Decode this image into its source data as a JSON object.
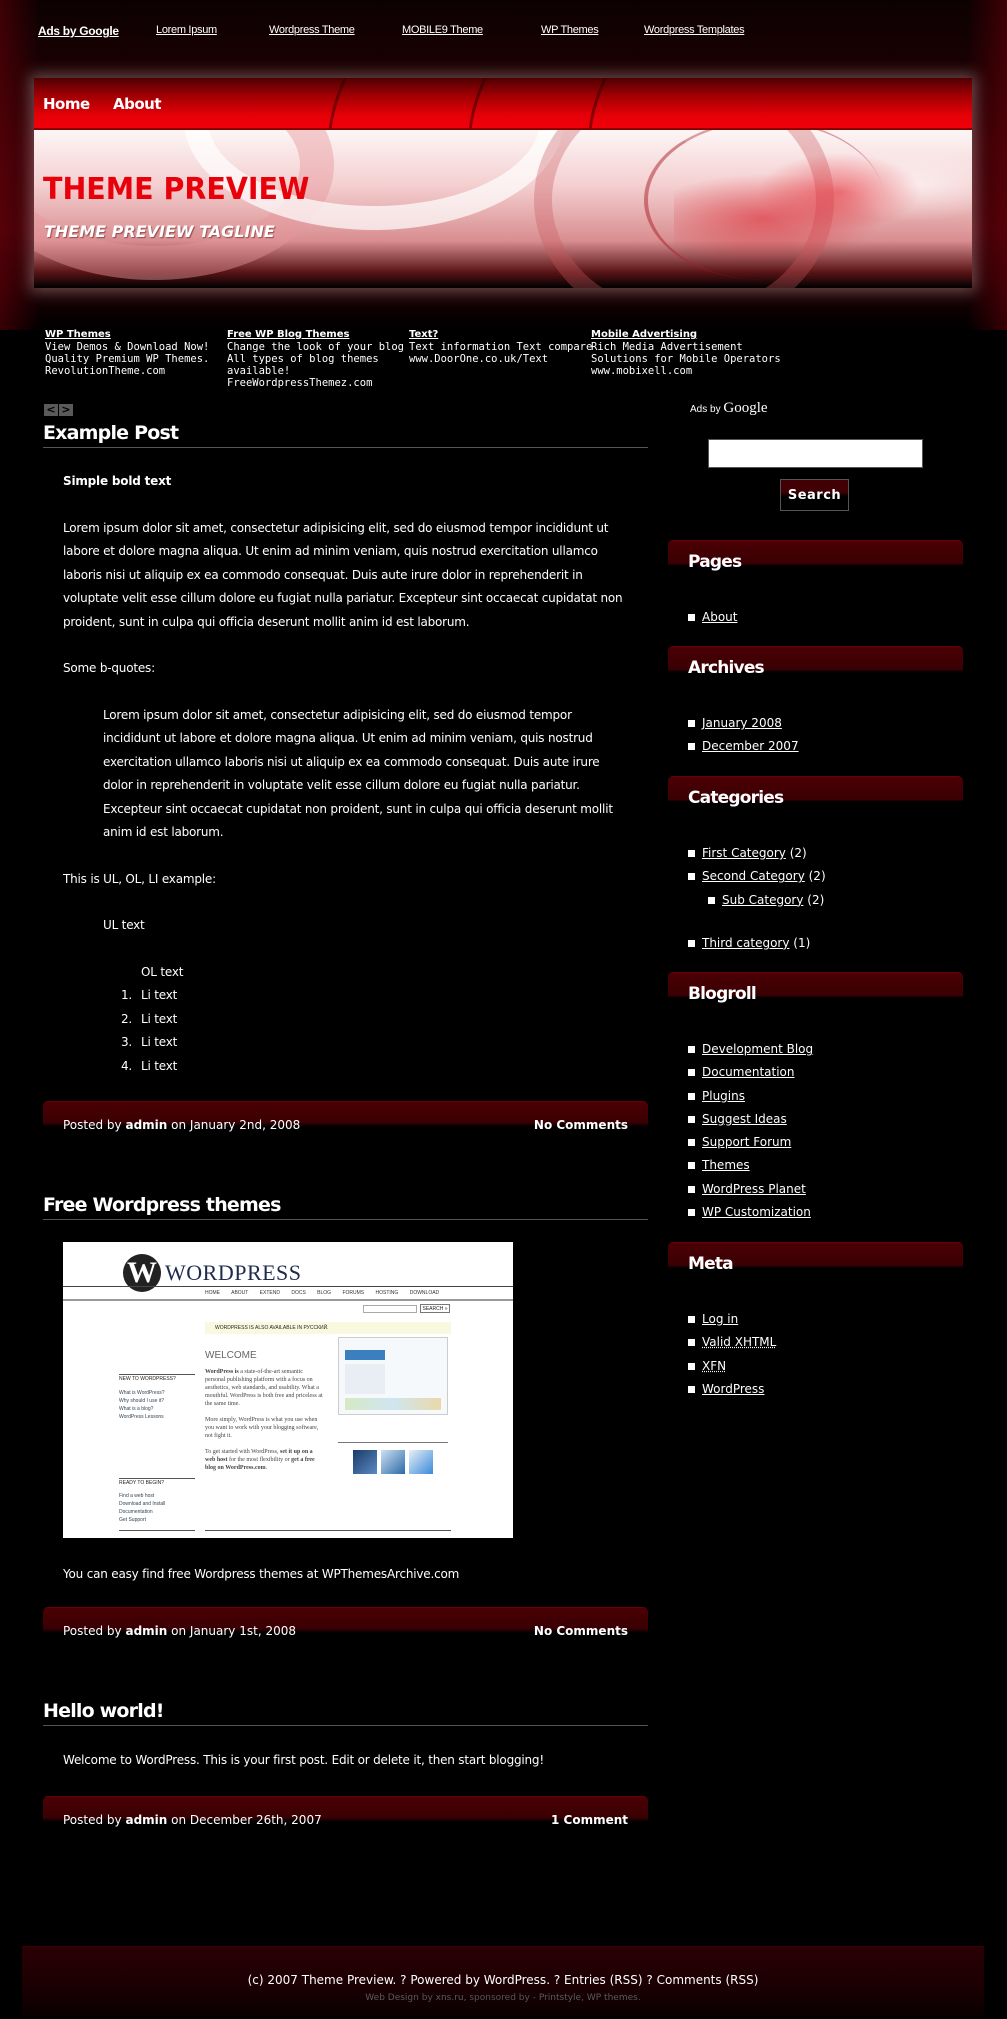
{
  "top_ads": {
    "ads_by": "Ads by Google",
    "links": [
      "Lorem Ipsum",
      "Wordpress Theme",
      "MOBILE9 Theme",
      "WP Themes",
      "Wordpress Templates"
    ]
  },
  "nav": {
    "items": [
      "Home",
      "About"
    ]
  },
  "header": {
    "title": "THEME PREVIEW",
    "tagline": "THEME PREVIEW TAGLINE"
  },
  "ad_row": [
    {
      "title": "WP Themes",
      "lines": [
        "View Demos & Download Now!",
        "Quality Premium WP Themes.",
        "RevolutionTheme.com"
      ]
    },
    {
      "title": "Free WP Blog Themes",
      "lines": [
        "Change the look of your blog",
        "All types of blog themes",
        "available!",
        "FreeWordpressThemez.com"
      ]
    },
    {
      "title": "Text?",
      "lines": [
        "Text information Text compare",
        "www.DoorOne.co.uk/Text"
      ]
    },
    {
      "title": "Mobile Advertising",
      "lines": [
        "Rich Media Advertisement",
        "Solutions for Mobile Operators",
        "www.mobixell.com"
      ]
    }
  ],
  "post_nav": {
    "prev": "<",
    "next": ">"
  },
  "posts": [
    {
      "title": "Example Post",
      "bold": "Simple bold text",
      "paragraph": "Lorem ipsum dolor sit amet, consectetur adipisicing elit, sed do eiusmod tempor incididunt ut labore et dolore magna aliqua. Ut enim ad minim veniam, quis nostrud exercitation ullamco laboris nisi ut aliquip ex ea commodo consequat. Duis aute irure dolor in reprehenderit in voluptate velit esse cillum dolore eu fugiat nulla pariatur. Excepteur sint occaecat cupidatat non proident, sunt in culpa qui officia deserunt mollit anim id est laborum.",
      "bquote_intro": "Some b-quotes:",
      "blockquote": "Lorem ipsum dolor sit amet, consectetur adipisicing elit, sed do eiusmod tempor incididunt ut labore et dolore magna aliqua. Ut enim ad minim veniam, quis nostrud exercitation ullamco laboris nisi ut aliquip ex ea commodo consequat. Duis aute irure dolor in reprehenderit in voluptate velit esse cillum dolore eu fugiat nulla pariatur. Excepteur sint occaecat cupidatat non proident, sunt in culpa qui officia deserunt mollit anim id est laborum.",
      "list_intro": "This is UL, OL, LI example:",
      "ul_text": "UL text",
      "ol_text": "OL text",
      "li_items": [
        "Li text",
        "Li text",
        "Li text",
        "Li text"
      ],
      "meta": {
        "posted_by": "Posted by",
        "author": "admin",
        "on": "on January 2nd, 2008",
        "comments": "No Comments"
      }
    },
    {
      "title": "Free Wordpress themes",
      "image_alt": "WordPress homepage screenshot",
      "text_before": "You can easy find free",
      "link": "Wordpress themes",
      "text_after": "at WPThemesArchive.com",
      "meta": {
        "posted_by": "Posted by",
        "author": "admin",
        "on": "on January 1st, 2008",
        "comments": "No Comments"
      }
    },
    {
      "title": "Hello world!",
      "text": "Welcome to WordPress. This is your first post. Edit or delete it, then start blogging!",
      "meta": {
        "posted_by": "Posted by",
        "author": "admin",
        "on": "on December 26th, 2007",
        "comments": "1 Comment"
      }
    }
  ],
  "screenshot": {
    "logo": "WORDPRESS",
    "nav": [
      "HOME",
      "ABOUT",
      "EXTEND",
      "DOCS",
      "BLOG",
      "FORUMS",
      "HOSTING",
      "DOWNLOAD"
    ],
    "search_btn": "SEARCH »",
    "notice": "WORDPRESS IS ALSO AVAILABLE IN РУССКИЙ.",
    "welcome": "WELCOME",
    "side_head_1": "NEW TO WORDPRESS?",
    "side_links_1": [
      "What is WordPress?",
      "Why should I use it?",
      "What is a blog?",
      "WordPress Lessons"
    ],
    "side_head_2": "READY TO BEGIN?",
    "side_links_2": [
      "Find a web host",
      "Download and Install",
      "Documentation",
      "Get Support"
    ]
  },
  "sidebar": {
    "ads_by": "Ads by",
    "google": "Google",
    "search_value": "",
    "search_button": "Search",
    "widgets": {
      "pages": {
        "title": "Pages",
        "items": [
          "About"
        ]
      },
      "archives": {
        "title": "Archives",
        "items": [
          "January 2008",
          "December 2007"
        ]
      },
      "categories": {
        "title": "Categories",
        "items": [
          {
            "label": "First Category",
            "count": "(2)"
          },
          {
            "label": "Second Category",
            "count": "(2)"
          },
          {
            "label": "Sub Category",
            "count": "(2)"
          },
          {
            "label": "Third category",
            "count": "(1)"
          }
        ]
      },
      "blogroll": {
        "title": "Blogroll",
        "items": [
          "Development Blog",
          "Documentation",
          "Plugins",
          "Suggest Ideas",
          "Support Forum",
          "Themes",
          "WordPress Planet",
          "WP Customization"
        ]
      },
      "meta": {
        "title": "Meta",
        "items": [
          "Log in",
          "Valid XHTML",
          "XFN",
          "WordPress"
        ]
      }
    }
  },
  "footer": {
    "copyright": "(c) 2007 Theme Preview. ? Powered by",
    "wordpress": "WordPress",
    "sep1": ". ?",
    "entries": "Entries (RSS)",
    "sep2": "?",
    "comments": "Comments (RSS)",
    "credit_web_design": "Web Design",
    "credit_by": "by",
    "credit_xns": "xns.ru",
    "credit_sponsored": ", sponsored by -",
    "credit_printstyle": "Printstyle",
    "credit_comma": ",",
    "credit_wp": "WP themes",
    "credit_end": "."
  },
  "colors": {
    "accent_red": "#e8000a",
    "dark_red": "#4a0004",
    "background": "#000000"
  }
}
